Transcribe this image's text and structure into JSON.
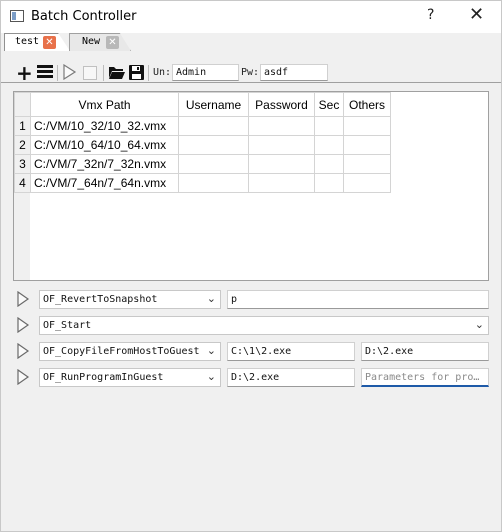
{
  "window": {
    "title": "Batch Controller",
    "help": "?",
    "close": "✕"
  },
  "tabs": [
    {
      "label": "test",
      "close": "✕"
    },
    {
      "label": "New",
      "close": "✕"
    }
  ],
  "toolbar": {
    "un_label": "Un:",
    "un_value": "Admin",
    "pw_label": "Pw:",
    "pw_value": "asdf"
  },
  "table": {
    "columns": [
      "Vmx Path",
      "Username",
      "Password",
      "Sec",
      "Others"
    ],
    "rows": [
      {
        "num": "1",
        "path": "C:/VM/10_32/10_32.vmx"
      },
      {
        "num": "2",
        "path": "C:/VM/10_64/10_64.vmx"
      },
      {
        "num": "3",
        "path": "C:/VM/7_32n/7_32n.vmx"
      },
      {
        "num": "4",
        "path": "C:/VM/7_64n/7_64n.vmx"
      }
    ]
  },
  "operations": [
    {
      "action": "OF_RevertToSnapshot",
      "param1": "p"
    },
    {
      "action": "OF_Start"
    },
    {
      "action": "OF_CopyFileFromHostToGuest",
      "param1": "C:\\1\\2.exe",
      "param2": "D:\\2.exe"
    },
    {
      "action": "OF_RunProgramInGuest",
      "param1": "D:\\2.exe",
      "param2_placeholder": "Parameters for pro…"
    }
  ]
}
